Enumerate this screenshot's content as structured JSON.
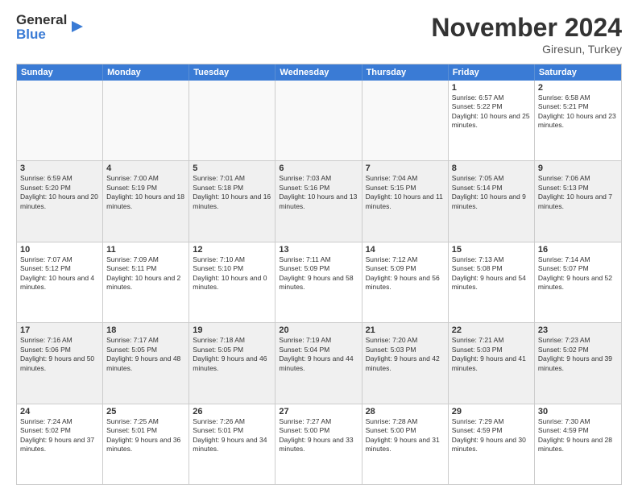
{
  "header": {
    "logo_line1": "General",
    "logo_line2": "Blue",
    "month_title": "November 2024",
    "location": "Giresun, Turkey"
  },
  "weekdays": [
    "Sunday",
    "Monday",
    "Tuesday",
    "Wednesday",
    "Thursday",
    "Friday",
    "Saturday"
  ],
  "weeks": [
    [
      {
        "day": "",
        "empty": true
      },
      {
        "day": "",
        "empty": true
      },
      {
        "day": "",
        "empty": true
      },
      {
        "day": "",
        "empty": true
      },
      {
        "day": "",
        "empty": true
      },
      {
        "day": "1",
        "rise": "6:57 AM",
        "set": "5:22 PM",
        "daylight": "10 hours and 25 minutes."
      },
      {
        "day": "2",
        "rise": "6:58 AM",
        "set": "5:21 PM",
        "daylight": "10 hours and 23 minutes."
      }
    ],
    [
      {
        "day": "3",
        "rise": "6:59 AM",
        "set": "5:20 PM",
        "daylight": "10 hours and 20 minutes."
      },
      {
        "day": "4",
        "rise": "7:00 AM",
        "set": "5:19 PM",
        "daylight": "10 hours and 18 minutes."
      },
      {
        "day": "5",
        "rise": "7:01 AM",
        "set": "5:18 PM",
        "daylight": "10 hours and 16 minutes."
      },
      {
        "day": "6",
        "rise": "7:03 AM",
        "set": "5:16 PM",
        "daylight": "10 hours and 13 minutes."
      },
      {
        "day": "7",
        "rise": "7:04 AM",
        "set": "5:15 PM",
        "daylight": "10 hours and 11 minutes."
      },
      {
        "day": "8",
        "rise": "7:05 AM",
        "set": "5:14 PM",
        "daylight": "10 hours and 9 minutes."
      },
      {
        "day": "9",
        "rise": "7:06 AM",
        "set": "5:13 PM",
        "daylight": "10 hours and 7 minutes."
      }
    ],
    [
      {
        "day": "10",
        "rise": "7:07 AM",
        "set": "5:12 PM",
        "daylight": "10 hours and 4 minutes."
      },
      {
        "day": "11",
        "rise": "7:09 AM",
        "set": "5:11 PM",
        "daylight": "10 hours and 2 minutes."
      },
      {
        "day": "12",
        "rise": "7:10 AM",
        "set": "5:10 PM",
        "daylight": "10 hours and 0 minutes."
      },
      {
        "day": "13",
        "rise": "7:11 AM",
        "set": "5:09 PM",
        "daylight": "9 hours and 58 minutes."
      },
      {
        "day": "14",
        "rise": "7:12 AM",
        "set": "5:09 PM",
        "daylight": "9 hours and 56 minutes."
      },
      {
        "day": "15",
        "rise": "7:13 AM",
        "set": "5:08 PM",
        "daylight": "9 hours and 54 minutes."
      },
      {
        "day": "16",
        "rise": "7:14 AM",
        "set": "5:07 PM",
        "daylight": "9 hours and 52 minutes."
      }
    ],
    [
      {
        "day": "17",
        "rise": "7:16 AM",
        "set": "5:06 PM",
        "daylight": "9 hours and 50 minutes."
      },
      {
        "day": "18",
        "rise": "7:17 AM",
        "set": "5:05 PM",
        "daylight": "9 hours and 48 minutes."
      },
      {
        "day": "19",
        "rise": "7:18 AM",
        "set": "5:05 PM",
        "daylight": "9 hours and 46 minutes."
      },
      {
        "day": "20",
        "rise": "7:19 AM",
        "set": "5:04 PM",
        "daylight": "9 hours and 44 minutes."
      },
      {
        "day": "21",
        "rise": "7:20 AM",
        "set": "5:03 PM",
        "daylight": "9 hours and 42 minutes."
      },
      {
        "day": "22",
        "rise": "7:21 AM",
        "set": "5:03 PM",
        "daylight": "9 hours and 41 minutes."
      },
      {
        "day": "23",
        "rise": "7:23 AM",
        "set": "5:02 PM",
        "daylight": "9 hours and 39 minutes."
      }
    ],
    [
      {
        "day": "24",
        "rise": "7:24 AM",
        "set": "5:02 PM",
        "daylight": "9 hours and 37 minutes."
      },
      {
        "day": "25",
        "rise": "7:25 AM",
        "set": "5:01 PM",
        "daylight": "9 hours and 36 minutes."
      },
      {
        "day": "26",
        "rise": "7:26 AM",
        "set": "5:01 PM",
        "daylight": "9 hours and 34 minutes."
      },
      {
        "day": "27",
        "rise": "7:27 AM",
        "set": "5:00 PM",
        "daylight": "9 hours and 33 minutes."
      },
      {
        "day": "28",
        "rise": "7:28 AM",
        "set": "5:00 PM",
        "daylight": "9 hours and 31 minutes."
      },
      {
        "day": "29",
        "rise": "7:29 AM",
        "set": "4:59 PM",
        "daylight": "9 hours and 30 minutes."
      },
      {
        "day": "30",
        "rise": "7:30 AM",
        "set": "4:59 PM",
        "daylight": "9 hours and 28 minutes."
      }
    ]
  ]
}
